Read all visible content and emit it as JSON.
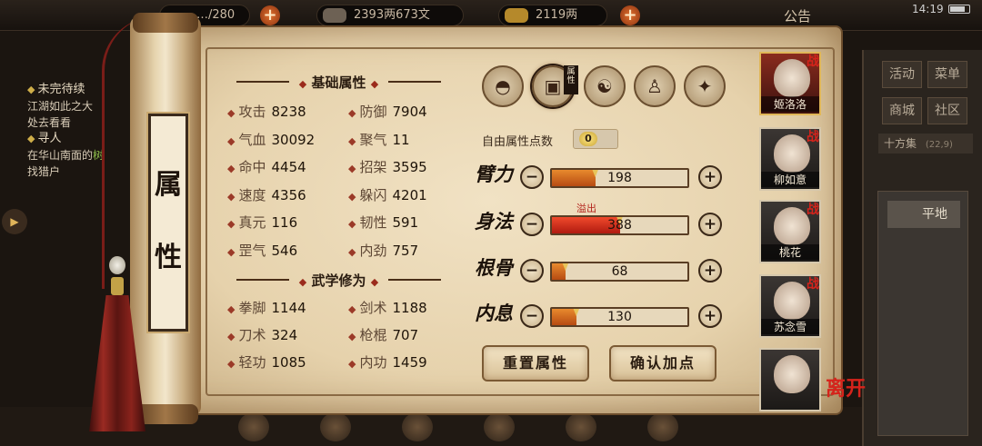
{
  "topbar": {
    "resource1_value": "…/280",
    "silver_value": "2393两673文",
    "gold_value": "2119两",
    "notice_label": "公告",
    "time": "14:19"
  },
  "quest": {
    "section1": "未完待续",
    "line1": "江湖如此之大",
    "line2": "处去看看",
    "section2": "寻人",
    "line3_a": "在华山南面的",
    "line3_b": "树",
    "line4": "找猎户"
  },
  "scroll_title": [
    "属",
    "性"
  ],
  "basic": {
    "title": "基础属性",
    "rows": [
      [
        {
          "label": "攻击",
          "value": "8238"
        },
        {
          "label": "防御",
          "value": "7904"
        }
      ],
      [
        {
          "label": "气血",
          "value": "30092"
        },
        {
          "label": "聚气",
          "value": "11"
        }
      ],
      [
        {
          "label": "命中",
          "value": "4454"
        },
        {
          "label": "招架",
          "value": "3595"
        }
      ],
      [
        {
          "label": "速度",
          "value": "4356"
        },
        {
          "label": "躲闪",
          "value": "4201"
        }
      ],
      [
        {
          "label": "真元",
          "value": "116"
        },
        {
          "label": "韧性",
          "value": "591"
        }
      ],
      [
        {
          "label": "罡气",
          "value": "546"
        },
        {
          "label": "内劲",
          "value": "757"
        }
      ]
    ]
  },
  "martial": {
    "title": "武学修为",
    "rows": [
      [
        {
          "label": "拳脚",
          "value": "1144"
        },
        {
          "label": "剑术",
          "value": "1188"
        }
      ],
      [
        {
          "label": "刀术",
          "value": "324"
        },
        {
          "label": "枪棍",
          "value": "707"
        }
      ],
      [
        {
          "label": "轻功",
          "value": "1085"
        },
        {
          "label": "内功",
          "value": "1459"
        }
      ]
    ]
  },
  "icons": [
    "hat-icon",
    "attribute-icon",
    "yinyang-icon",
    "body-icon",
    "compass-icon"
  ],
  "icon_tag": "属性",
  "free_points": {
    "label": "自由属性点数",
    "value": "0"
  },
  "stats": [
    {
      "name": "臂力",
      "value": "198",
      "fill": 0.32
    },
    {
      "name": "身法",
      "value": "388",
      "fill": 0.5,
      "overflow": "溢出"
    },
    {
      "name": "根骨",
      "value": "68",
      "fill": 0.1
    },
    {
      "name": "内息",
      "value": "130",
      "fill": 0.18
    }
  ],
  "buttons": {
    "reset": "重置属性",
    "confirm": "确认加点"
  },
  "characters": [
    {
      "name": "姬洛洛",
      "tag": "战",
      "active": true
    },
    {
      "name": "柳如意",
      "tag": "战",
      "active": false
    },
    {
      "name": "桃花",
      "tag": "战",
      "active": false
    },
    {
      "name": "苏念雪",
      "tag": "战",
      "active": false
    },
    {
      "name": "",
      "tag": "",
      "active": false
    }
  ],
  "leave_label": "离开",
  "right_menu": [
    "活动",
    "菜单",
    "商城",
    "社区"
  ],
  "right_info": {
    "place": "十方集",
    "coord": "(22,9)",
    "terrain": "平地"
  }
}
